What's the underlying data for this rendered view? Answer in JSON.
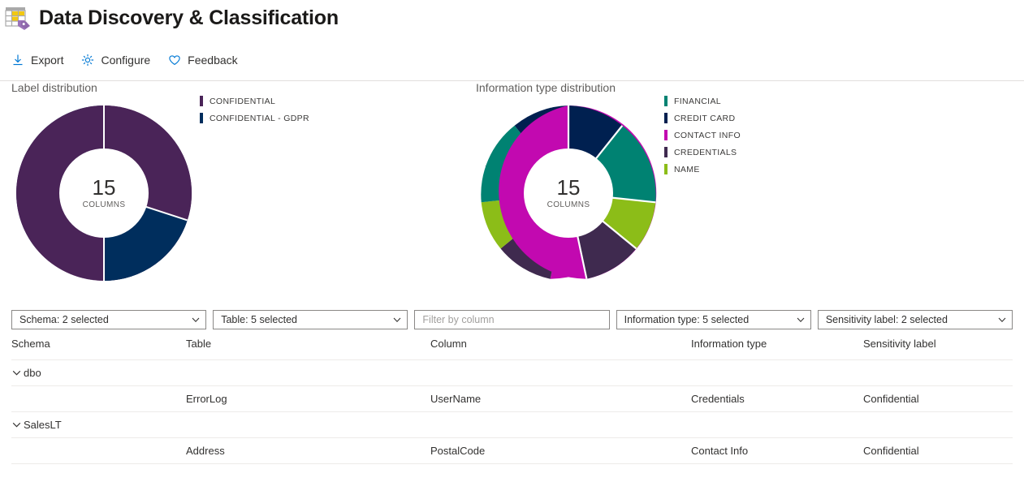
{
  "header": {
    "title": "Data Discovery & Classification",
    "icon": "table-tag-icon"
  },
  "toolbar": {
    "items": [
      {
        "label": "Export",
        "icon": "download-icon",
        "name": "export-button"
      },
      {
        "label": "Configure",
        "icon": "gear-icon",
        "name": "configure-button"
      },
      {
        "label": "Feedback",
        "icon": "heart-icon",
        "name": "feedback-button"
      }
    ]
  },
  "colors": {
    "accent": "#0078d4",
    "confidential": "#4a2458",
    "confidential_gdpr": "#002e5d",
    "financial": "#008272",
    "credit_card": "#002050",
    "contact_info": "#c209b0",
    "credentials": "#3f2a4f",
    "name": "#8cbd18"
  },
  "charts": [
    {
      "name": "label-distribution-chart",
      "title": "Label distribution",
      "center_value": "15",
      "center_unit": "COLUMNS"
    },
    {
      "name": "information-type-distribution-chart",
      "title": "Information type distribution",
      "center_value": "15",
      "center_unit": "COLUMNS"
    }
  ],
  "chart_data": [
    {
      "type": "pie",
      "title": "Label distribution",
      "subtitle": "15 COLUMNS",
      "categories": [
        "CONFIDENTIAL",
        "CONFIDENTIAL - GDPR"
      ],
      "values": [
        12,
        3
      ],
      "colors": [
        "#4a2458",
        "#002e5d"
      ],
      "legend": "right",
      "donut": true,
      "total": 15,
      "unit": "COLUMNS"
    },
    {
      "type": "pie",
      "title": "Information type distribution",
      "subtitle": "15 COLUMNS",
      "categories": [
        "CONTACT INFO",
        "CREDENTIALS",
        "NAME",
        "FINANCIAL",
        "CREDIT CARD"
      ],
      "values": [
        7,
        2,
        2,
        2,
        2
      ],
      "colors": [
        "#c209b0",
        "#3f2a4f",
        "#8cbd18",
        "#008272",
        "#002050"
      ],
      "legend_order": [
        "FINANCIAL",
        "CREDIT CARD",
        "CONTACT INFO",
        "CREDENTIALS",
        "NAME"
      ],
      "legend": "right",
      "donut": true,
      "total": 15,
      "unit": "COLUMNS"
    }
  ],
  "legends": {
    "label_distribution": [
      {
        "label": "CONFIDENTIAL",
        "color": "#4a2458"
      },
      {
        "label": "CONFIDENTIAL - GDPR",
        "color": "#002e5d"
      }
    ],
    "information_type": [
      {
        "label": "FINANCIAL",
        "color": "#008272"
      },
      {
        "label": "CREDIT CARD",
        "color": "#002050"
      },
      {
        "label": "CONTACT INFO",
        "color": "#c209b0"
      },
      {
        "label": "CREDENTIALS",
        "color": "#3f2a4f"
      },
      {
        "label": "NAME",
        "color": "#8cbd18"
      }
    ]
  },
  "filters": [
    {
      "name": "schema-filter",
      "value": "Schema: 2 selected",
      "type": "select"
    },
    {
      "name": "table-filter",
      "value": "Table: 5 selected",
      "type": "select"
    },
    {
      "name": "column-filter-input",
      "value": "",
      "placeholder": "Filter by column",
      "type": "text"
    },
    {
      "name": "information-type-filter",
      "value": "Information type: 5 selected",
      "type": "select"
    },
    {
      "name": "sensitivity-label-filter",
      "value": "Sensitivity label: 2 selected",
      "type": "select"
    }
  ],
  "table": {
    "headers": [
      "Schema",
      "Table",
      "Column",
      "Information type",
      "Sensitivity label"
    ],
    "rows": [
      {
        "kind": "group",
        "schema": "dbo",
        "table": "",
        "column": "",
        "info_type": "",
        "label": ""
      },
      {
        "kind": "data",
        "schema": "",
        "table": "ErrorLog",
        "column": "UserName",
        "info_type": "Credentials",
        "label": "Confidential"
      },
      {
        "kind": "group",
        "schema": "SalesLT",
        "table": "",
        "column": "",
        "info_type": "",
        "label": ""
      },
      {
        "kind": "data",
        "schema": "",
        "table": "Address",
        "column": "PostalCode",
        "info_type": "Contact Info",
        "label": "Confidential"
      }
    ]
  }
}
